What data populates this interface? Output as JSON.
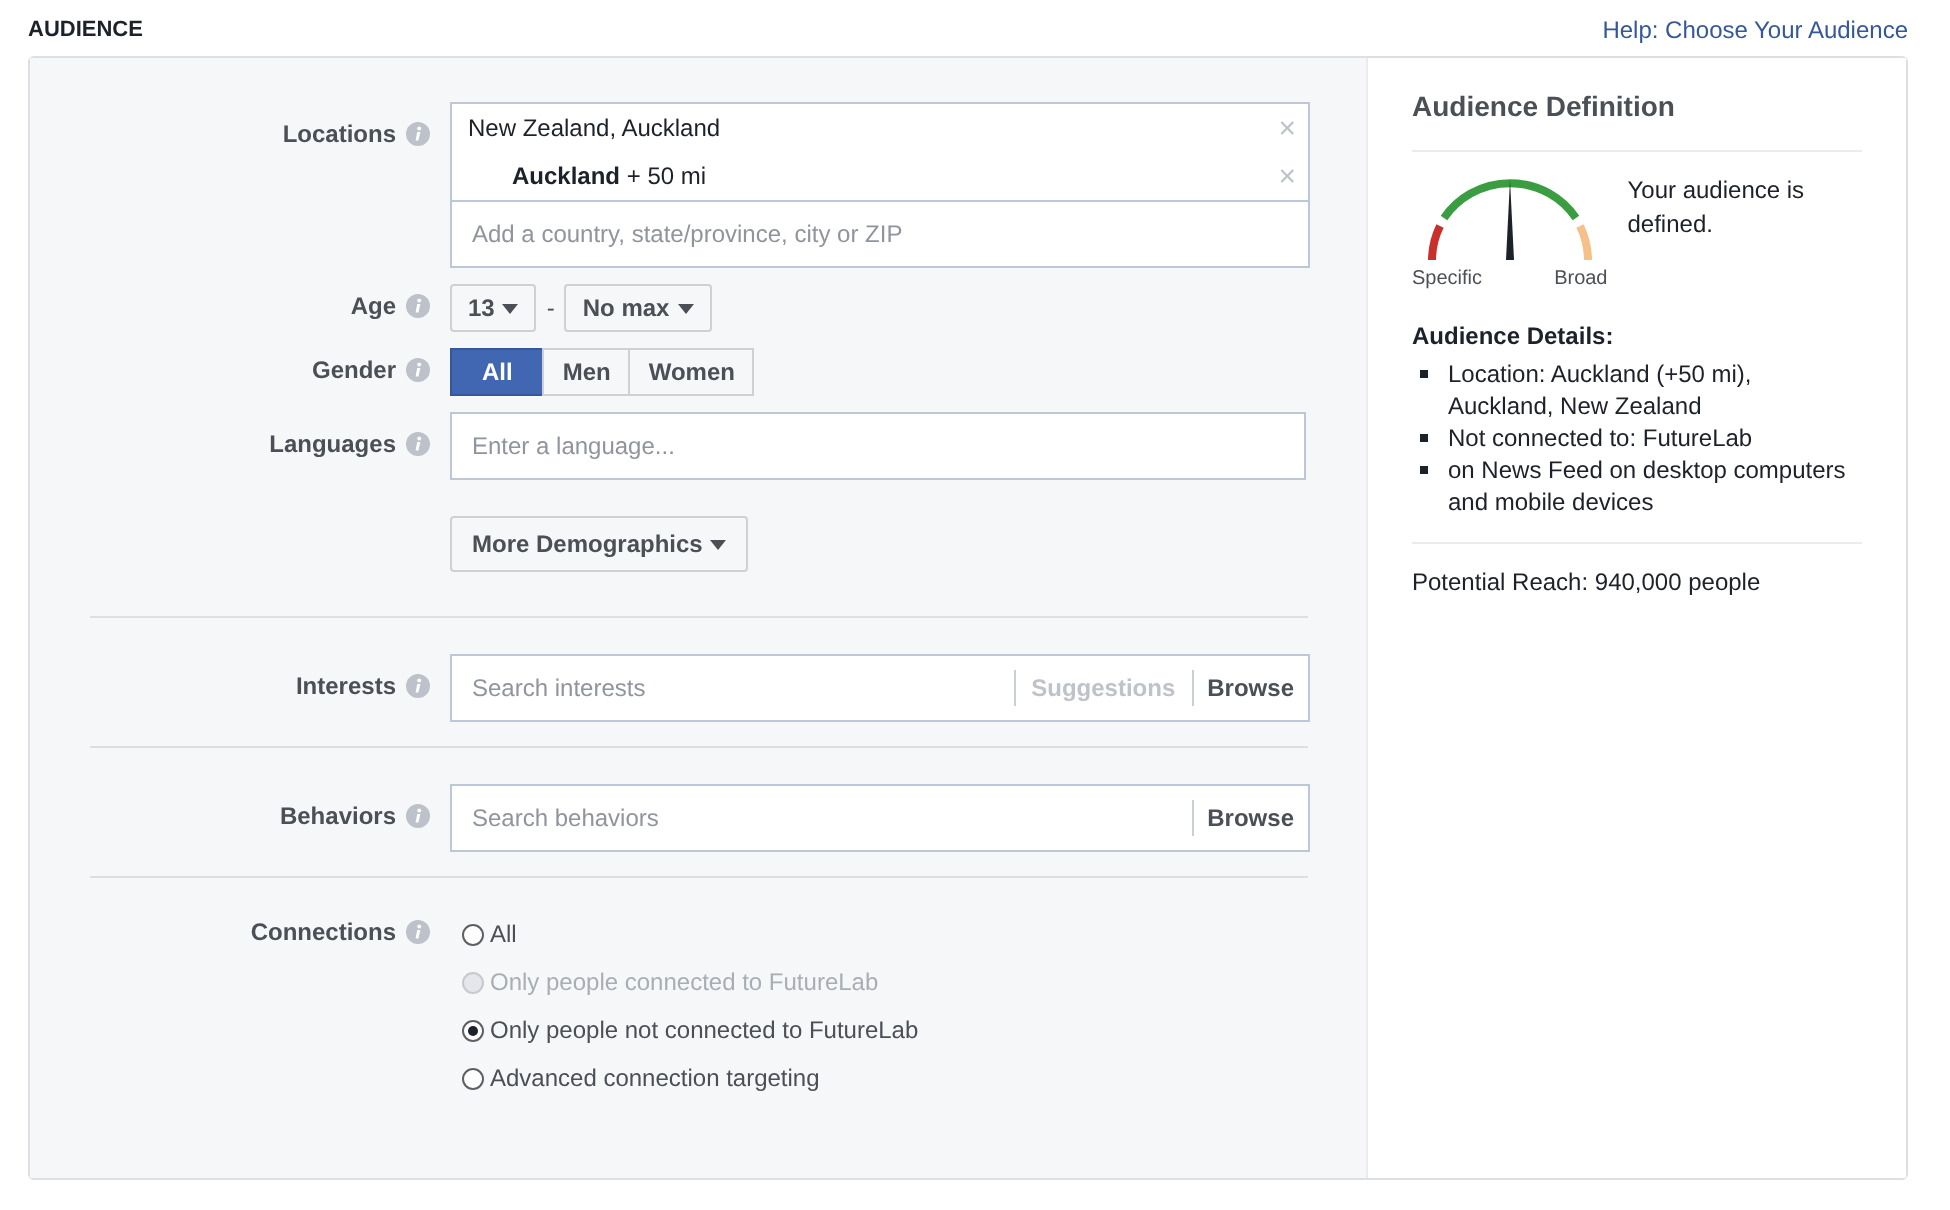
{
  "header": {
    "title": "AUDIENCE",
    "help_link": "Help: Choose Your Audience"
  },
  "locations": {
    "label": "Locations",
    "items": [
      {
        "text": "New Zealand, Auckland",
        "remove": "×"
      },
      {
        "text": "**Auckland** + 50 mi",
        "remove": "×"
      }
    ],
    "placeholder": "Add a country, state/province, city or ZIP"
  },
  "age": {
    "label": "Age",
    "min": "13",
    "separator": "-",
    "max": "No max"
  },
  "gender": {
    "label": "Gender",
    "options": [
      {
        "label": "All",
        "selected": true
      },
      {
        "label": "Men",
        "selected": false
      },
      {
        "label": "Women",
        "selected": false
      }
    ]
  },
  "languages": {
    "label": "Languages",
    "placeholder": "Enter a language..."
  },
  "more_demographics": "More Demographics",
  "interests": {
    "label": "Interests",
    "placeholder": "Search interests",
    "suggestions": "Suggestions",
    "browse": "Browse"
  },
  "behaviors": {
    "label": "Behaviors",
    "placeholder": "Search behaviors",
    "browse": "Browse"
  },
  "connections": {
    "label": "Connections",
    "options": [
      {
        "label": "All",
        "selected": false,
        "disabled": false
      },
      {
        "label": "Only people connected to FutureLab",
        "selected": false,
        "disabled": true
      },
      {
        "label": "Only people not connected to FutureLab",
        "selected": true,
        "disabled": false
      },
      {
        "label": "Advanced connection targeting",
        "selected": false,
        "disabled": false
      }
    ]
  },
  "definition": {
    "title": "Audience Definition",
    "gauge": {
      "level": 0.5,
      "low_label": "Specific",
      "high_label": "Broad"
    },
    "status": "Your audience is defined.",
    "details_title": "Audience Details:",
    "details": [
      "Location: Auckland (+50 mi), Auckland, New Zealand",
      "Not connected to: FutureLab",
      "on News Feed on desktop computers and mobile devices"
    ],
    "reach": "Potential Reach: 940,000 people"
  }
}
